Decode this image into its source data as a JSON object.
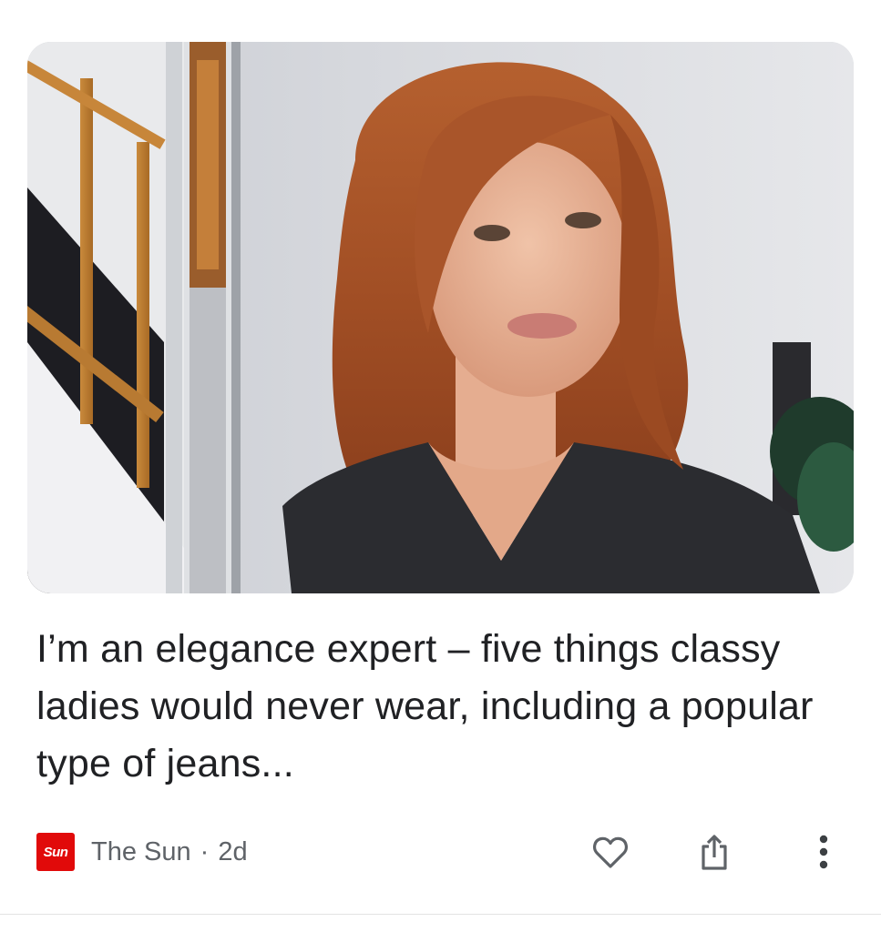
{
  "article": {
    "image_alt": "Woman with wavy auburn hair wearing a dark top, standing next to a staircase",
    "headline": "I’m an elegance expert – five things classy ladies would never wear, including a popular type of jeans...",
    "source": {
      "name": "The Sun",
      "logo_text": "Sun",
      "logo_color": "#e10a0a"
    },
    "separator": "·",
    "age": "2d"
  },
  "actions": {
    "like_icon": "heart-outline-icon",
    "share_icon": "share-icon",
    "more_icon": "more-vertical-icon"
  }
}
